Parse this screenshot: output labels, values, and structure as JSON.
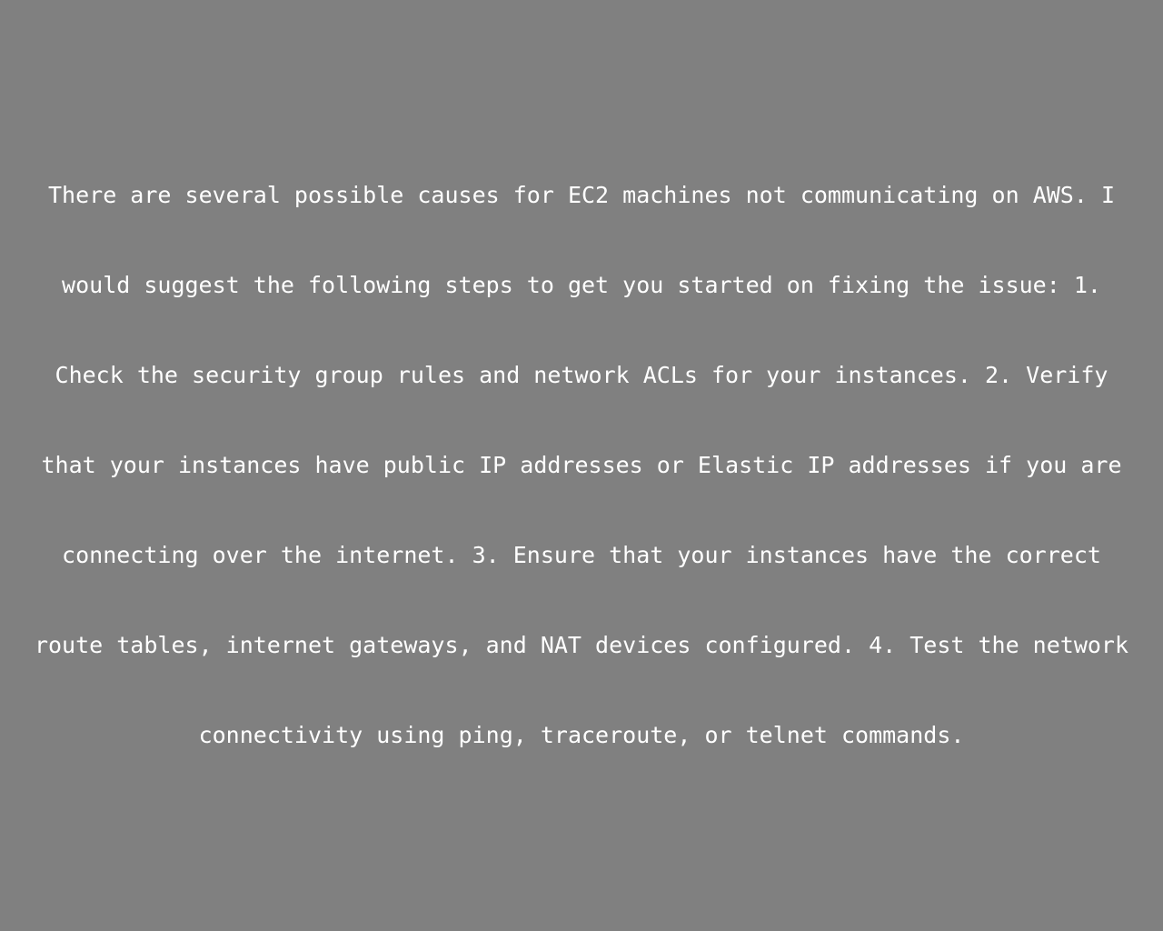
{
  "background_color": "#808080",
  "text_color": "#ffffff",
  "message": {
    "lines": [
      "There are several possible causes for EC2 machines not communicating on AWS. I",
      "would suggest the following steps to get you started on fixing the issue: 1.",
      "Check the security group rules and network ACLs for your instances. 2. Verify",
      "that your instances have public IP addresses or Elastic IP addresses if you are",
      "connecting over the internet. 3. Ensure that your instances have the correct",
      "route tables, internet gateways, and NAT devices configured. 4. Test the network",
      "connectivity using ping, traceroute, or telnet commands."
    ]
  }
}
